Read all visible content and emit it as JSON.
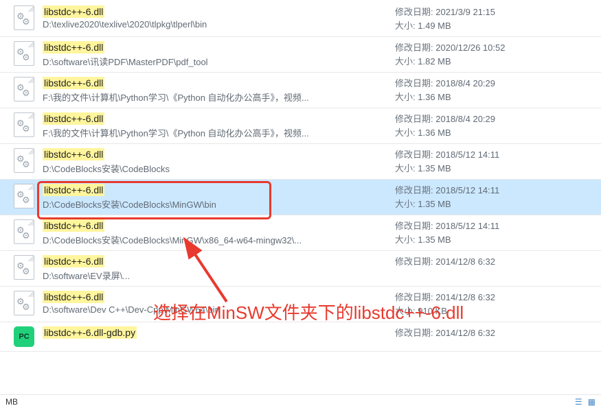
{
  "labels": {
    "mod_date": "修改日期:",
    "size": "大小:",
    "status_left": "MB"
  },
  "annotation": "选择在MinSW文件夹下的libstdc++-6.dll",
  "files": [
    {
      "name": "libstdc++-6.dll",
      "path": "D:\\texlive2020\\texlive\\2020\\tlpkg\\tlperl\\bin",
      "date": "2021/3/9 21:15",
      "size": "1.49 MB",
      "icon": "dll",
      "selected": false,
      "boxed": false
    },
    {
      "name": "libstdc++-6.dll",
      "path": "D:\\software\\讯读PDF\\MasterPDF\\pdf_tool",
      "date": "2020/12/26 10:52",
      "size": "1.82 MB",
      "icon": "dll",
      "selected": false,
      "boxed": false
    },
    {
      "name": "libstdc++-6.dll",
      "path": "F:\\我的文件\\计算机\\Python学习\\《Python 自动化办公高手》，视频...",
      "date": "2018/8/4 20:29",
      "size": "1.36 MB",
      "icon": "dll",
      "selected": false,
      "boxed": false
    },
    {
      "name": "libstdc++-6.dll",
      "path": "F:\\我的文件\\计算机\\Python学习\\《Python 自动化办公高手》，视频...",
      "date": "2018/8/4 20:29",
      "size": "1.36 MB",
      "icon": "dll",
      "selected": false,
      "boxed": false
    },
    {
      "name": "libstdc++-6.dll",
      "path": "D:\\CodeBlocks安装\\CodeBlocks",
      "date": "2018/5/12 14:11",
      "size": "1.35 MB",
      "icon": "dll",
      "selected": false,
      "boxed": false
    },
    {
      "name": "libstdc++-6.dll",
      "path": "D:\\CodeBlocks安装\\CodeBlocks\\MinGW\\bin",
      "date": "2018/5/12 14:11",
      "size": "1.35 MB",
      "icon": "dll",
      "selected": true,
      "boxed": true
    },
    {
      "name": "libstdc++-6.dll",
      "path": "D:\\CodeBlocks安装\\CodeBlocks\\MinGW\\x86_64-w64-mingw32\\...",
      "date": "2018/5/12 14:11",
      "size": "1.35 MB",
      "icon": "dll",
      "selected": false,
      "boxed": false
    },
    {
      "name": "libstdc++-6.dll",
      "path": "D:\\software\\EV录屏\\...",
      "date": "2014/12/8 6:32",
      "size": "",
      "icon": "dll",
      "selected": false,
      "boxed": false
    },
    {
      "name": "libstdc++-6.dll",
      "path": "D:\\software\\Dev C++\\Dev-Cpp\\MinGW64\\bin",
      "date": "2014/12/8 6:32",
      "size": "910 KB",
      "icon": "dll",
      "selected": false,
      "boxed": false
    },
    {
      "name": "libstdc++-6.dll-gdb.py",
      "path": "",
      "date": "2014/12/8 6:32",
      "size": "",
      "icon": "py",
      "selected": false,
      "boxed": false
    }
  ]
}
